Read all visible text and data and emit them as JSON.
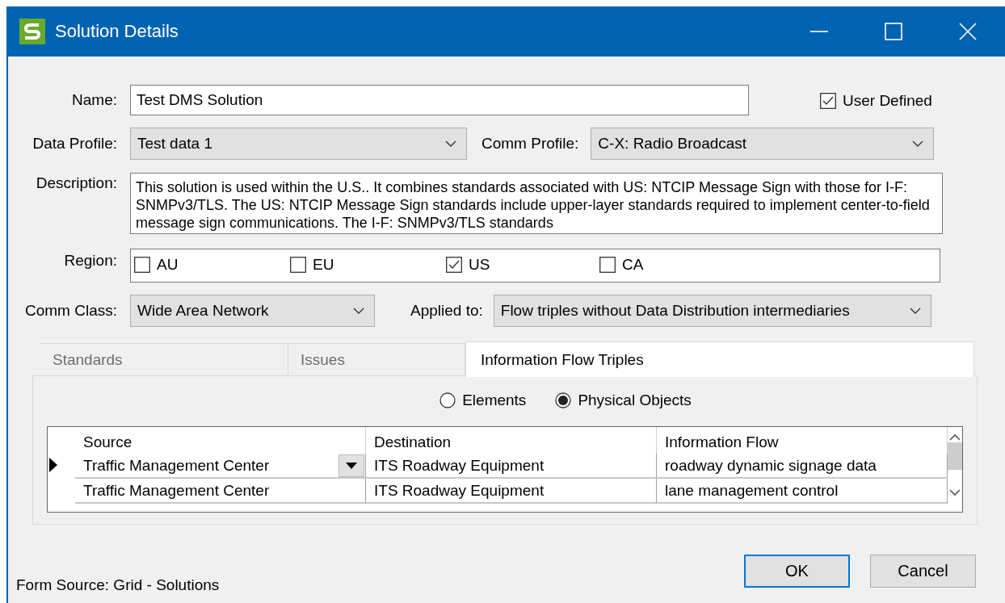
{
  "window": {
    "title": "Solution Details"
  },
  "name": {
    "label": "Name:",
    "value": "Test DMS Solution"
  },
  "user_defined": {
    "label": "User Defined",
    "checked": true
  },
  "data_profile": {
    "label": "Data Profile:",
    "value": "Test data 1"
  },
  "comm_profile": {
    "label": "Comm Profile:",
    "value": "C-X: Radio Broadcast"
  },
  "description": {
    "label": "Description:",
    "value": "This solution is used within the U.S..  It combines standards associated with US: NTCIP Message Sign with those for I-F: SNMPv3/TLS. The US: NTCIP Message Sign standards include upper-layer standards required to implement center-to-field message sign communications.  The I-F: SNMPv3/TLS standards"
  },
  "region": {
    "label": "Region:",
    "options": [
      {
        "label": "AU",
        "checked": false
      },
      {
        "label": "EU",
        "checked": false
      },
      {
        "label": "US",
        "checked": true
      },
      {
        "label": "CA",
        "checked": false
      }
    ]
  },
  "comm_class": {
    "label": "Comm Class:",
    "value": "Wide Area Network"
  },
  "applied_to": {
    "label": "Applied to:",
    "value": "Flow triples without Data Distribution intermediaries"
  },
  "tabs": [
    {
      "label": "Standards",
      "selected": false
    },
    {
      "label": "Issues",
      "selected": false
    },
    {
      "label": "Information Flow Triples",
      "selected": true
    }
  ],
  "view_options": [
    {
      "label": "Elements",
      "selected": false
    },
    {
      "label": "Physical Objects",
      "selected": true
    }
  ],
  "table": {
    "columns": [
      "Source",
      "Destination",
      "Information Flow"
    ],
    "rows": [
      {
        "cells": [
          "Traffic Management Center",
          "ITS Roadway Equipment",
          "roadway dynamic signage data"
        ],
        "selected": true
      },
      {
        "cells": [
          "Traffic Management Center",
          "ITS Roadway Equipment",
          "lane management control"
        ],
        "selected": false
      }
    ]
  },
  "buttons": [
    {
      "label": "OK",
      "default": true
    },
    {
      "label": "Cancel",
      "default": false
    }
  ],
  "status_bar": "Form Source: Grid - Solutions"
}
